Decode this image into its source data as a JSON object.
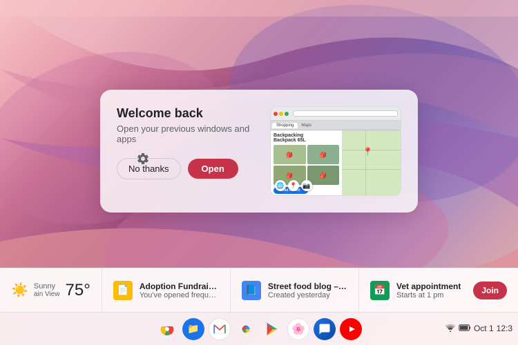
{
  "wallpaper": {
    "alt": "ChromeOS abstract pink purple wallpaper"
  },
  "welcome_card": {
    "title": "Welcome back",
    "subtitle": "Open your previous windows and apps",
    "btn_no_thanks": "No thanks",
    "btn_open": "Open",
    "preview_alt": "Browser window preview with backpack shopping page and map"
  },
  "notification_bar": {
    "weather": {
      "condition": "Sunny",
      "location": "ain View",
      "temperature": "75°"
    },
    "items": [
      {
        "id": "adoption-fundraiser",
        "icon": "📄",
        "icon_color": "#fbbc05",
        "title": "Adoption Fundraiser",
        "subtitle": "You've opened frequently"
      },
      {
        "id": "street-food-blog",
        "icon": "📘",
        "icon_color": "#4285f4",
        "title": "Street food blog – Rough draft",
        "subtitle": "Created yesterday"
      },
      {
        "id": "vet-appointment",
        "icon": "📅",
        "icon_color": "#0f9d58",
        "title": "Vet appointment",
        "subtitle": "Starts at 1 pm",
        "has_join_btn": true,
        "join_label": "Join"
      }
    ]
  },
  "shelf": {
    "icons": [
      {
        "id": "chrome",
        "label": "Chrome",
        "symbol": "⬤",
        "color_class": "chrome"
      },
      {
        "id": "files",
        "label": "Files",
        "symbol": "📁",
        "color_class": "files"
      },
      {
        "id": "gmail",
        "label": "Gmail",
        "symbol": "M",
        "color_class": "gmail"
      },
      {
        "id": "photos",
        "label": "Photos",
        "symbol": "🖼",
        "color_class": "photos"
      },
      {
        "id": "play",
        "label": "Play Store",
        "symbol": "▶",
        "color_class": "play"
      },
      {
        "id": "photos2",
        "label": "Google Photos",
        "symbol": "🌸",
        "color_class": "photos2"
      },
      {
        "id": "messages",
        "label": "Messages",
        "symbol": "💬",
        "color_class": "messages"
      },
      {
        "id": "youtube",
        "label": "YouTube",
        "symbol": "▶",
        "color_class": "youtube"
      }
    ]
  },
  "system_tray": {
    "network_icon": "wifi",
    "battery_icon": "battery",
    "date": "Oct 1",
    "time": "12:3"
  },
  "mini_app_icons": [
    {
      "id": "chrome-mini",
      "symbol": "🌐"
    },
    {
      "id": "maps-mini",
      "symbol": "📍"
    },
    {
      "id": "photos-mini",
      "symbol": "📷"
    }
  ]
}
